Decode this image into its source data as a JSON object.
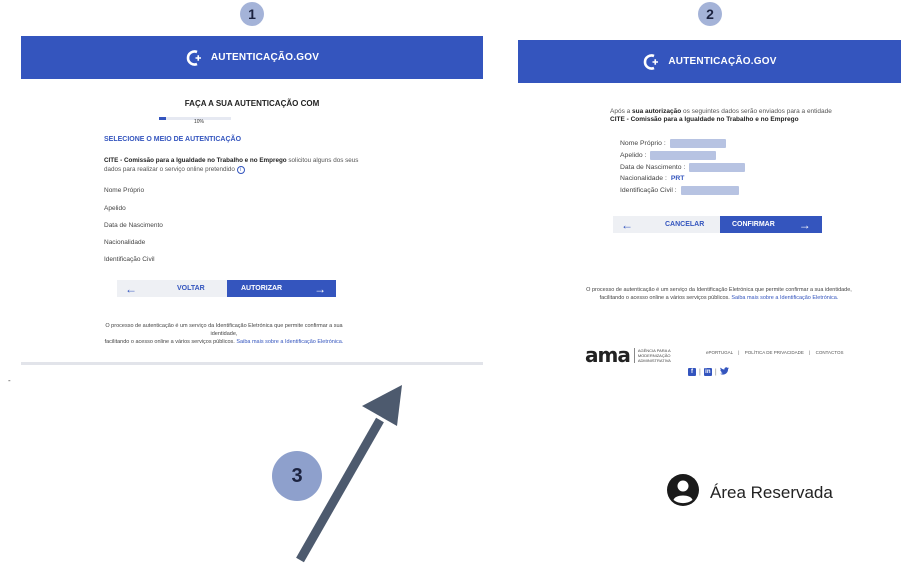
{
  "steps": {
    "one": "1",
    "two": "2",
    "three": "3"
  },
  "header": {
    "brand": "AUTENTICAÇÃO.GOV"
  },
  "screen1": {
    "title": "FAÇA A SUA AUTENTICAÇÃO COM",
    "progress_label": "10%",
    "progress_fraction": 0.1,
    "subtitle": "SELECIONE O MEIO DE AUTENTICAÇÃO",
    "entity": "CITE - Comissão para a Igualdade no Trabalho e no Emprego",
    "desc_rest": " solicitou alguns dos seus dados para realizar o serviço online pretendido",
    "fields": [
      "Nome Próprio",
      "Apelido",
      "Data de Nascimento",
      "Nacionalidade",
      "Identificação Civil"
    ],
    "back_label": "VOLTAR",
    "authorize_label": "AUTORIZAR",
    "footer_line1": "O processo de autenticação é um serviço da Identificação Eletrónica que permite confirmar a sua identidade,",
    "footer_line2": "facilitando o acesso online a vários serviços públicos.",
    "footer_link": "Saiba mais sobre a Identificação Eletrónica."
  },
  "screen2": {
    "intro_a": "Após a ",
    "intro_b": "sua autorização",
    "intro_c": " os seguintes dados serão enviados para a entidade ",
    "intro_entity": "CITE - Comissão para a Igualdade no Trabalho e no Emprego",
    "fields": [
      {
        "label": "Nome Próprio :",
        "value": ""
      },
      {
        "label": "Apelido :",
        "value": ""
      },
      {
        "label": "Data de Nascimento :",
        "value": ""
      },
      {
        "label": "Nacionalidade :",
        "value": "PRT"
      },
      {
        "label": "Identificação Civil :",
        "value": ""
      }
    ],
    "cancel_label": "CANCELAR",
    "confirm_label": "CONFIRMAR",
    "footer_line1": "O processo de autenticação é um serviço da Identificação Eletrónica que permite confirmar a sua identidade,",
    "footer_line2": "facilitando o acesso online a vários serviços públicos.",
    "footer_link": "Saiba mais sobre a Identificação Eletrónica.",
    "ama_logo": "ama",
    "ama_sub1": "AGÊNCIA PARA A",
    "ama_sub2": "MODERNIZAÇÃO",
    "ama_sub3": "ADMINISTRATIVA",
    "links": [
      "ePORTUGAL",
      "POLÍTICA DE PRIVACIDADE",
      "CONTACTOS"
    ],
    "social": [
      "facebook-icon",
      "linkedin-icon",
      "twitter-icon"
    ]
  },
  "reserved": {
    "label": "Área Reservada"
  },
  "colors": {
    "primary": "#3455be",
    "step_badge": "#a4b3d8",
    "arrow": "#4d5a6e"
  }
}
